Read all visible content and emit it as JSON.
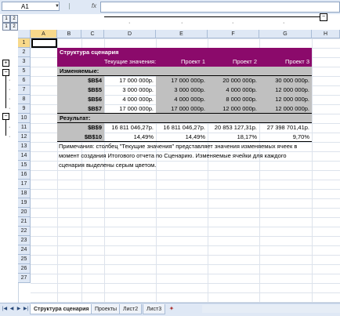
{
  "formula_bar": {
    "name_box": "A1",
    "fx": "fx",
    "formula": ""
  },
  "outline": {
    "col_levels": [
      "1",
      "2"
    ],
    "row_levels": [
      "1",
      "2"
    ],
    "collapse": "−",
    "expand": "+"
  },
  "columns": [
    "A",
    "B",
    "C",
    "D",
    "E",
    "F",
    "G",
    "H"
  ],
  "rows": [
    "1",
    "2",
    "3",
    "5",
    "6",
    "7",
    "8",
    "9",
    "10",
    "11",
    "12",
    "13",
    "14",
    "15",
    "16",
    "17",
    "18",
    "19",
    "20",
    "21",
    "22",
    "23",
    "24",
    "25",
    "26",
    "27"
  ],
  "report": {
    "title": "Структура сценария",
    "header_current": "Текущие значения:",
    "header_p1": "Проект 1",
    "header_p2": "Проект 2",
    "header_p3": "Проект 3",
    "changing_label": "Изменяемые:",
    "result_label": "Результат:",
    "changing_rows": [
      {
        "cell": "$B$4",
        "current": "17 000 000р.",
        "p1": "17 000 000р.",
        "p2": "20 000 000р.",
        "p3": "30 000 000р."
      },
      {
        "cell": "$B$5",
        "current": "3 000 000р.",
        "p1": "3 000 000р.",
        "p2": "4 000 000р.",
        "p3": "12 000 000р."
      },
      {
        "cell": "$B$6",
        "current": "4 000 000р.",
        "p1": "4 000 000р.",
        "p2": "8 000 000р.",
        "p3": "12 000 000р."
      },
      {
        "cell": "$B$7",
        "current": "17 000 000р.",
        "p1": "17 000 000р.",
        "p2": "12 000 000р.",
        "p3": "12 000 000р."
      }
    ],
    "result_rows": [
      {
        "cell": "$B$9",
        "current": "16 811 046,27р.",
        "p1": "16 811 046,27р.",
        "p2": "20 853 127,31р.",
        "p3": "27 398 701,41р."
      },
      {
        "cell": "$B$10",
        "current": "14,49%",
        "p1": "14,49%",
        "p2": "18,17%",
        "p3": "9,70%"
      }
    ],
    "note_lines": [
      "Примечания: столбец \"Текущие значения\" представляет значения изменяемых ячеек в",
      "момент создания Итогового отчета по Сценарию. Изменяемые ячейки для каждого",
      "сценария выделены серым цветом."
    ]
  },
  "tabs": [
    "Структура сценария",
    "Проекты",
    "Лист2",
    "Лист3"
  ],
  "colors": {
    "title_bg": "#8b0a6b",
    "gray": "#c0c0c0",
    "header_bg": "#dfe8f5",
    "selected_header": "#f8d98b"
  }
}
